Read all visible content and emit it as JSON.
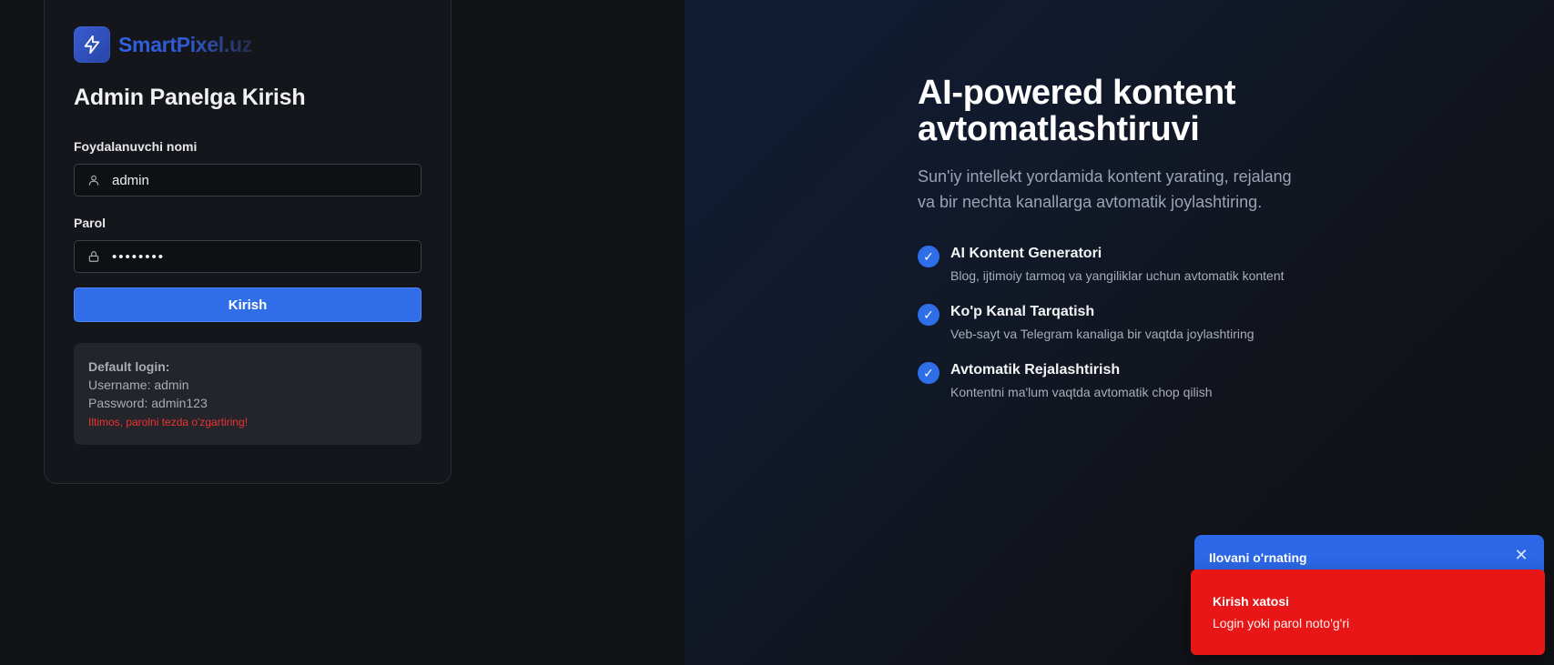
{
  "brand": {
    "name": "SmartPixel.uz",
    "icon": "lightning-bolt-icon",
    "icon_color": "#2f63e6"
  },
  "login": {
    "title": "Admin Panelga Kirish",
    "username_label": "Foydalanuvchi nomi",
    "username_value": "admin",
    "username_icon": "user-icon",
    "password_label": "Parol",
    "password_value": "••••••••",
    "password_icon": "lock-icon",
    "submit_label": "Kirish",
    "accent": "#2f6ee8"
  },
  "default_login": {
    "heading": "Default login:",
    "username_line": "Username: admin",
    "password_line": "Password: admin123",
    "warning": "Iltimos, parolni tezda o'zgartiring!",
    "warning_color": "#ee3333"
  },
  "hero": {
    "title_line1": "AI-powered kontent",
    "title_line2": "avtomatlashtiruvi",
    "subtitle_line1": "Sun'iy intellekt yordamida kontent yarating, rejalang",
    "subtitle_line2": "va bir nechta kanallarga avtomatik joylashtiring.",
    "features": [
      {
        "title": "AI Kontent Generatori",
        "desc": "Blog, ijtimoiy tarmoq va yangiliklar uchun avtomatik kontent",
        "icon": "check-icon"
      },
      {
        "title": "Ko'p Kanal Tarqatish",
        "desc": "Veb-sayt va Telegram kanaliga bir vaqtda joylashtiring",
        "icon": "check-icon"
      },
      {
        "title": "Avtomatik Rejalashtirish",
        "desc": "Kontentni ma'lum vaqtda avtomatik chop qilish",
        "icon": "check-icon"
      }
    ]
  },
  "toasts": {
    "install": {
      "title": "Ilovani o'rnating",
      "close_icon": "close-icon",
      "color": "#2b67e6"
    },
    "error": {
      "title": "Kirish xatosi",
      "message": "Login yoki parol noto'g'ri",
      "color": "#e81616"
    }
  }
}
